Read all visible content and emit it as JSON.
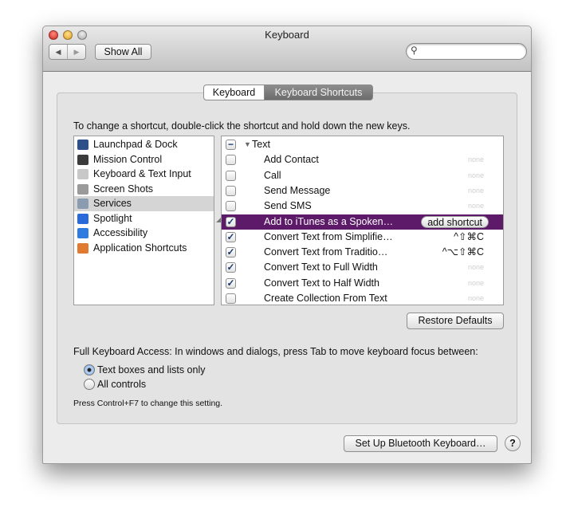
{
  "window": {
    "title": "Keyboard"
  },
  "toolbar": {
    "back": "◀",
    "forward": "▶",
    "show_all": "Show All",
    "search_placeholder": ""
  },
  "tabs": [
    {
      "label": "Keyboard",
      "selected": false
    },
    {
      "label": "Keyboard Shortcuts",
      "selected": true
    }
  ],
  "instruction": "To change a shortcut, double-click the shortcut and hold down the new keys.",
  "categories": [
    {
      "label": "Launchpad & Dock",
      "icon": "launchpad-icon",
      "color": "#2d4f8a"
    },
    {
      "label": "Mission Control",
      "icon": "mission-control-icon",
      "color": "#3b3b3b"
    },
    {
      "label": "Keyboard & Text Input",
      "icon": "keyboard-icon",
      "color": "#c8c8c8"
    },
    {
      "label": "Screen Shots",
      "icon": "camera-icon",
      "color": "#9a9a9a"
    },
    {
      "label": "Services",
      "icon": "gear-icon",
      "color": "#8a9cb0",
      "selected": true
    },
    {
      "label": "Spotlight",
      "icon": "spotlight-icon",
      "color": "#2a6ad8"
    },
    {
      "label": "Accessibility",
      "icon": "accessibility-icon",
      "color": "#2f7be0"
    },
    {
      "label": "Application Shortcuts",
      "icon": "app-shortcuts-icon",
      "color": "#e07a30"
    }
  ],
  "services": {
    "group": {
      "label": "Text",
      "state": "mixed"
    },
    "items": [
      {
        "name": "Add Contact",
        "checked": false,
        "shortcut": "none"
      },
      {
        "name": "Call",
        "checked": false,
        "shortcut": "none"
      },
      {
        "name": "Send Message",
        "checked": false,
        "shortcut": "none"
      },
      {
        "name": "Send SMS",
        "checked": false,
        "shortcut": "none"
      },
      {
        "name": "Add to iTunes as a Spoken…",
        "checked": true,
        "shortcut": "add shortcut",
        "selected": true
      },
      {
        "name": "Convert Text from Simplifie…",
        "checked": true,
        "shortcut": "^⇧⌘C"
      },
      {
        "name": "Convert Text from Traditio…",
        "checked": true,
        "shortcut": "^⌥⇧⌘C"
      },
      {
        "name": "Convert Text to Full Width",
        "checked": true,
        "shortcut": "none"
      },
      {
        "name": "Convert Text to Half Width",
        "checked": true,
        "shortcut": "none"
      },
      {
        "name": "Create Collection From Text",
        "checked": false,
        "shortcut": "none"
      }
    ]
  },
  "restore_defaults": "Restore Defaults",
  "full_keyboard_access": {
    "label": "Full Keyboard Access: In windows and dialogs, press Tab to move keyboard focus between:",
    "options": [
      {
        "label": "Text boxes and lists only",
        "selected": true
      },
      {
        "label": "All controls",
        "selected": false
      }
    ],
    "hint": "Press Control+F7 to change this setting."
  },
  "bluetooth_button": "Set Up Bluetooth Keyboard…",
  "help": "?",
  "colors": {
    "selection": "#5c1a68",
    "accent": "#2f7be0"
  }
}
